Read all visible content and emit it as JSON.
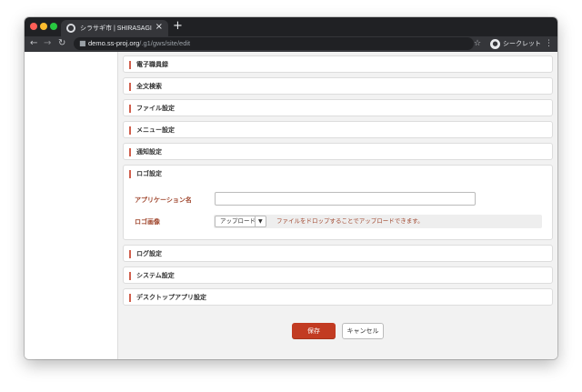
{
  "browser": {
    "tab_title": "シラサギ市 | SHIRASAGI",
    "tab_close": "×",
    "new_tab": "+",
    "url_host": "demo.ss-proj.org",
    "url_path": "/.g1/gws/site/edit",
    "incognito_label": "シークレット"
  },
  "sections_top": [
    {
      "title": "電子職員録"
    },
    {
      "title": "全文検索"
    },
    {
      "title": "ファイル設定"
    },
    {
      "title": "メニュー設定"
    },
    {
      "title": "通知設定"
    }
  ],
  "logo_section": {
    "title": "ロゴ設定",
    "app_name_label": "アプリケーション名",
    "app_name_value": "",
    "logo_image_label": "ロゴ画像",
    "upload_button": "アップロード",
    "drop_hint": "ファイルをドロップすることでアップロードできます。"
  },
  "sections_bottom": [
    {
      "title": "ログ設定"
    },
    {
      "title": "システム設定"
    },
    {
      "title": "デスクトップアプリ設定"
    }
  ],
  "actions": {
    "save": "保存",
    "cancel": "キャンセル"
  },
  "colors": {
    "accent": "#c23b22",
    "label": "#a0472e",
    "section_marker": "#d0604e"
  }
}
